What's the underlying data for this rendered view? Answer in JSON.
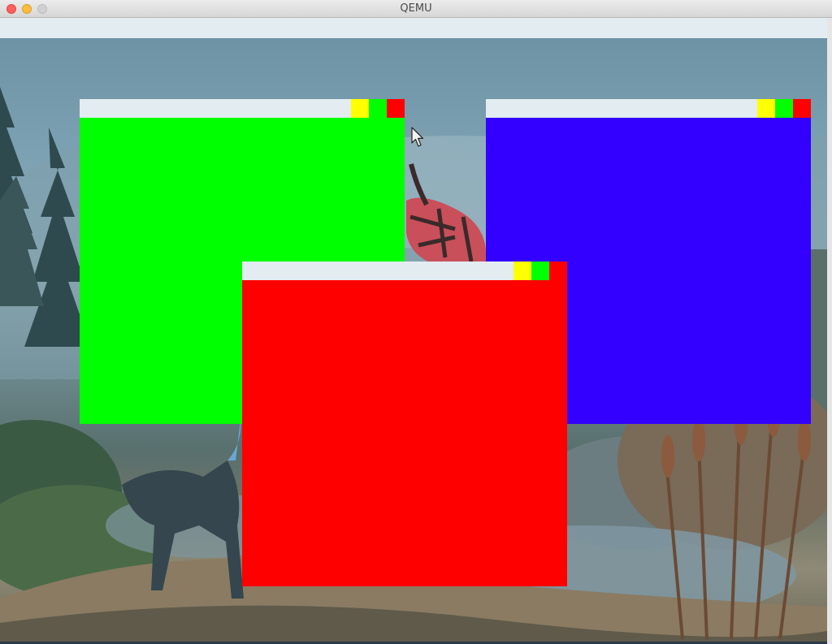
{
  "host": {
    "title": "QEMU"
  },
  "colors": {
    "minimize": "#ffff00",
    "maximize": "#00ff00",
    "close": "#ff0000",
    "titlebar": "#e2ecf1"
  },
  "windows": [
    {
      "id": "green",
      "body_color": "#00ff00"
    },
    {
      "id": "blue",
      "body_color": "#3300ff"
    },
    {
      "id": "red",
      "body_color": "#ff0000"
    }
  ],
  "cursor": {
    "icon": "mouse-pointer-icon"
  }
}
